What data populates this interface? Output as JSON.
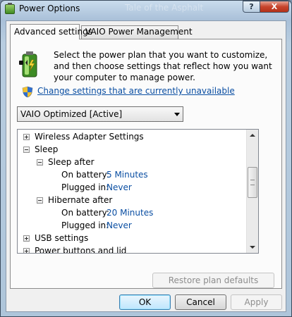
{
  "window": {
    "title": "Power Options",
    "background_title": "Tale of the Asphalt",
    "help_label": "?",
    "close_label": "X"
  },
  "tabs": [
    {
      "label": "Advanced settings",
      "active": true
    },
    {
      "label": "VAIO Power Management",
      "active": false
    }
  ],
  "intro": "Select the power plan that you want to customize, and then choose settings that reflect how you want your computer to manage power.",
  "change_link": "Change settings that are currently unavailable",
  "plan_select": {
    "value": "VAIO Optimized [Active]"
  },
  "tree": {
    "wireless": "Wireless Adapter Settings",
    "sleep": "Sleep",
    "sleep_after": "Sleep after",
    "sleep_battery_label": "On battery:",
    "sleep_battery_value": "5 Minutes",
    "sleep_plugged_label": "Plugged in:",
    "sleep_plugged_value": "Never",
    "hibernate_after": "Hibernate after",
    "hib_battery_label": "On battery:",
    "hib_battery_value": "20 Minutes",
    "hib_plugged_label": "Plugged in:",
    "hib_plugged_value": "Never",
    "usb": "USB settings",
    "power_buttons": "Power buttons and lid"
  },
  "buttons": {
    "restore": "Restore plan defaults",
    "ok": "OK",
    "cancel": "Cancel",
    "apply": "Apply"
  },
  "colors": {
    "link": "#0a4ea2",
    "close_button": "#c8452c"
  },
  "icons": [
    "power-options-icon",
    "battery-plug-icon",
    "uac-shield-icon",
    "expand-icon",
    "collapse-icon",
    "dropdown-arrow-icon"
  ]
}
